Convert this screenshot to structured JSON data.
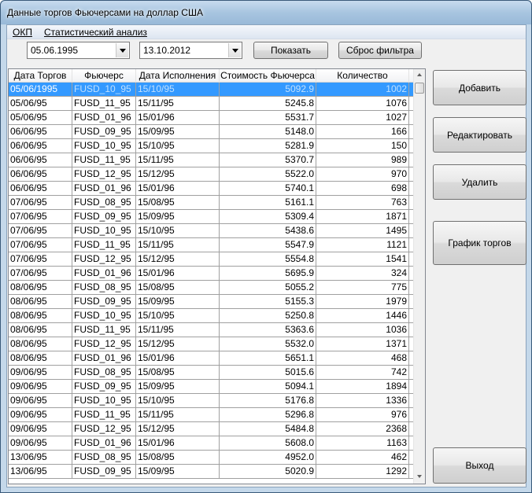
{
  "window": {
    "title": "Данные торгов Фьючерсами на доллар США"
  },
  "menu": [
    "ОКП",
    "Статистический анализ"
  ],
  "filter": {
    "date_from": "05.06.1995",
    "date_to": "13.10.2012",
    "show_label": "Показать",
    "reset_label": "Сброс фильтра"
  },
  "grid": {
    "columns": [
      "Дата Торгов",
      "Фьючерс",
      "Дата Исполнения",
      "Стоимость Фьючерса",
      "Количество"
    ],
    "rows": [
      [
        "05/06/1995",
        "FUSD_10_95",
        "15/10/95",
        "5092.9",
        "1002"
      ],
      [
        "05/06/95",
        "FUSD_11_95",
        "15/11/95",
        "5245.8",
        "1076"
      ],
      [
        "05/06/95",
        "FUSD_01_96",
        "15/01/96",
        "5531.7",
        "1027"
      ],
      [
        "06/06/95",
        "FUSD_09_95",
        "15/09/95",
        "5148.0",
        "166"
      ],
      [
        "06/06/95",
        "FUSD_10_95",
        "15/10/95",
        "5281.9",
        "150"
      ],
      [
        "06/06/95",
        "FUSD_11_95",
        "15/11/95",
        "5370.7",
        "989"
      ],
      [
        "06/06/95",
        "FUSD_12_95",
        "15/12/95",
        "5522.0",
        "970"
      ],
      [
        "06/06/95",
        "FUSD_01_96",
        "15/01/96",
        "5740.1",
        "698"
      ],
      [
        "07/06/95",
        "FUSD_08_95",
        "15/08/95",
        "5161.1",
        "763"
      ],
      [
        "07/06/95",
        "FUSD_09_95",
        "15/09/95",
        "5309.4",
        "1871"
      ],
      [
        "07/06/95",
        "FUSD_10_95",
        "15/10/95",
        "5438.6",
        "1495"
      ],
      [
        "07/06/95",
        "FUSD_11_95",
        "15/11/95",
        "5547.9",
        "1121"
      ],
      [
        "07/06/95",
        "FUSD_12_95",
        "15/12/95",
        "5554.8",
        "1541"
      ],
      [
        "07/06/95",
        "FUSD_01_96",
        "15/01/96",
        "5695.9",
        "324"
      ],
      [
        "08/06/95",
        "FUSD_08_95",
        "15/08/95",
        "5055.2",
        "775"
      ],
      [
        "08/06/95",
        "FUSD_09_95",
        "15/09/95",
        "5155.3",
        "1979"
      ],
      [
        "08/06/95",
        "FUSD_10_95",
        "15/10/95",
        "5250.8",
        "1446"
      ],
      [
        "08/06/95",
        "FUSD_11_95",
        "15/11/95",
        "5363.6",
        "1036"
      ],
      [
        "08/06/95",
        "FUSD_12_95",
        "15/12/95",
        "5532.0",
        "1371"
      ],
      [
        "08/06/95",
        "FUSD_01_96",
        "15/01/96",
        "5651.1",
        "468"
      ],
      [
        "09/06/95",
        "FUSD_08_95",
        "15/08/95",
        "5015.6",
        "742"
      ],
      [
        "09/06/95",
        "FUSD_09_95",
        "15/09/95",
        "5094.1",
        "1894"
      ],
      [
        "09/06/95",
        "FUSD_10_95",
        "15/10/95",
        "5176.8",
        "1336"
      ],
      [
        "09/06/95",
        "FUSD_11_95",
        "15/11/95",
        "5296.8",
        "976"
      ],
      [
        "09/06/95",
        "FUSD_12_95",
        "15/12/95",
        "5484.8",
        "2368"
      ],
      [
        "09/06/95",
        "FUSD_01_96",
        "15/01/96",
        "5608.0",
        "1163"
      ],
      [
        "13/06/95",
        "FUSD_08_95",
        "15/08/95",
        "4952.0",
        "462"
      ],
      [
        "13/06/95",
        "FUSD_09_95",
        "15/09/95",
        "5020.9",
        "1292"
      ]
    ]
  },
  "side_buttons": {
    "add": "Добавить",
    "edit": "Редактировать",
    "delete": "Удалить",
    "chart": "График торгов",
    "exit": "Выход"
  }
}
